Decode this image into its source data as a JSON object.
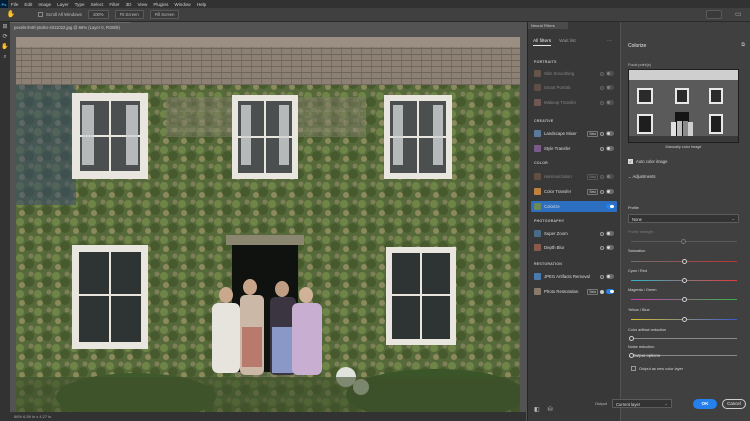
{
  "app": {
    "logo": "Ps"
  },
  "menu": [
    "File",
    "Edit",
    "Image",
    "Layer",
    "Type",
    "Select",
    "Filter",
    "3D",
    "View",
    "Plugins",
    "Window",
    "Help"
  ],
  "options": {
    "scroll_all_windows": "Scroll All Windows",
    "buttons": [
      "100%",
      "Fit Screen",
      "Fill Screen"
    ]
  },
  "document": {
    "tab_title": "pexels-lmtrl-jmdsn-4011022.jpg @ 66% (Layer 0, RGB/8)",
    "status": "66%   6.59 in x 4.27 in"
  },
  "filters_panel": {
    "tab": "Neural Filters",
    "tabs": [
      "All filters",
      "Wait list"
    ],
    "categories": {
      "portraits": "PORTRAITS",
      "creative": "CREATIVE",
      "color": "COLOR",
      "photography": "PHOTOGRAPHY",
      "restoration": "RESTORATION"
    },
    "filters": [
      {
        "name": "Skin Smoothing",
        "beta": "",
        "state": "off",
        "disabled": true,
        "color": "#a07860"
      },
      {
        "name": "Smart Portrait",
        "beta": "",
        "state": "off",
        "disabled": true,
        "color": "#8a6a5a"
      },
      {
        "name": "Makeup Transfer",
        "beta": "",
        "state": "off",
        "disabled": true,
        "color": "#b08070"
      },
      {
        "name": "Landscape Mixer",
        "beta": "Beta",
        "state": "off",
        "disabled": false,
        "color": "#5a7a9a"
      },
      {
        "name": "Style Transfer",
        "beta": "",
        "state": "off",
        "disabled": false,
        "color": "#7a5a8a"
      },
      {
        "name": "Harmonization",
        "beta": "Beta",
        "state": "off",
        "disabled": true,
        "color": "#9a6a4a"
      },
      {
        "name": "Color Transfer",
        "beta": "Beta",
        "state": "off",
        "disabled": false,
        "color": "#c08040"
      },
      {
        "name": "Colorize",
        "beta": "",
        "state": "on",
        "disabled": false,
        "selected": true,
        "color": "#6a8a5a"
      },
      {
        "name": "Super Zoom",
        "beta": "",
        "state": "off",
        "disabled": false,
        "color": "#4a6a8a"
      },
      {
        "name": "Depth Blur",
        "beta": "",
        "state": "off",
        "disabled": false,
        "color": "#8a5a4a"
      },
      {
        "name": "JPEG Artifacts Removal",
        "beta": "",
        "state": "off",
        "disabled": false,
        "color": "#4a7ab0"
      },
      {
        "name": "Photo Restoration",
        "beta": "Beta",
        "state": "on",
        "disabled": false,
        "color": "#8a7a6a"
      }
    ]
  },
  "colorize": {
    "title": "Colorize",
    "focal_label": "Focal point(s)",
    "preview_caption": "Manually color image",
    "auto_color_label": "Auto color image",
    "adjustments_label": "Adjustments",
    "profile_label": "Profile",
    "profile_value": "None",
    "profile_strength_label": "Profile strength",
    "sliders": [
      {
        "label": "Saturation",
        "value": 0.5,
        "gradient": "linear-gradient(90deg,#707070,#c03030)",
        "muted": false
      },
      {
        "label": "Cyan / Red",
        "value": 0.5,
        "gradient": "linear-gradient(90deg,#2fb7c9,#e03a3a)",
        "muted": false
      },
      {
        "label": "Magenta / Green",
        "value": 0.5,
        "gradient": "linear-gradient(90deg,#c040b0,#3ab04a)",
        "muted": false
      },
      {
        "label": "Yellow / Blue",
        "value": 0.5,
        "gradient": "linear-gradient(90deg,#d8c030,#3a5ad0)",
        "muted": false
      },
      {
        "label": "Color artifact reduction",
        "value": 0.0,
        "gradient": "linear-gradient(90deg,#8a8a8a,#8a8a8a)",
        "muted": false
      },
      {
        "label": "Noise reduction",
        "value": 0.0,
        "gradient": "linear-gradient(90deg,#8a8a8a,#8a8a8a)",
        "muted": false
      }
    ],
    "output_options_label": "Output options",
    "output_new_layer_label": "Output as new color layer",
    "output_label": "Output",
    "output_value": "Current layer",
    "ok_label": "OK",
    "cancel_label": "Cancel"
  }
}
